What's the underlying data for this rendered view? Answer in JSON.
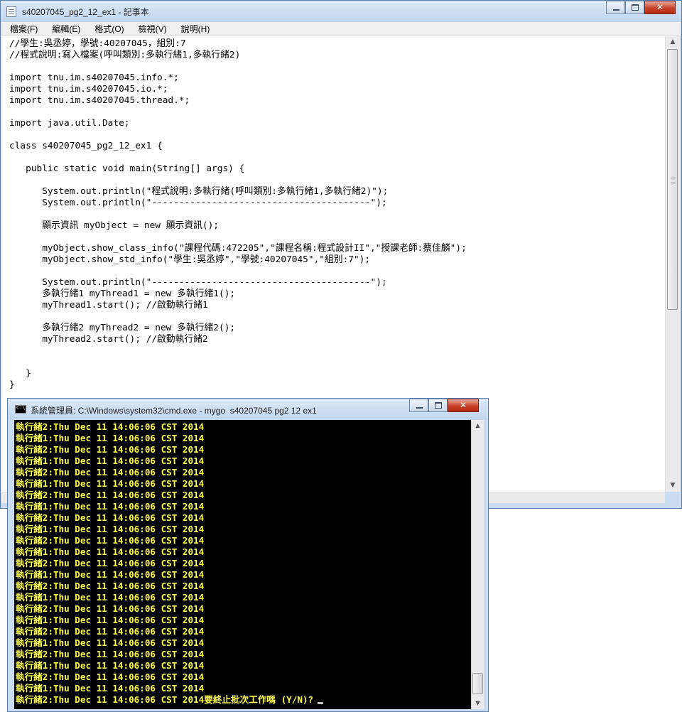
{
  "notepad": {
    "title": "s40207045_pg2_12_ex1 - 記事本",
    "menu": [
      "檔案(F)",
      "編輯(E)",
      "格式(O)",
      "檢視(V)",
      "說明(H)"
    ],
    "code_lines": [
      "//學生:吳丞婷，學號:40207045，組別:7",
      "//程式說明:寫入檔案(呼叫類別:多執行緒1,多執行緒2)",
      "",
      "import tnu.im.s40207045.info.*;",
      "import tnu.im.s40207045.io.*;",
      "import tnu.im.s40207045.thread.*;",
      "",
      "import java.util.Date;",
      "",
      "class s40207045_pg2_12_ex1 {",
      "",
      "   public static void main(String[] args) {",
      "",
      "      System.out.println(\"程式說明:多執行緒(呼叫類別:多執行緒1,多執行緒2)\");",
      "      System.out.println(\"----------------------------------------\");",
      "",
      "      顯示資訊 myObject = new 顯示資訊();",
      "",
      "      myObject.show_class_info(\"課程代碼:472205\",\"課程名稱:程式設計II\",\"授課老師:蔡佳麟\");",
      "      myObject.show_std_info(\"學生:吳丞婷\",\"學號:40207045\",\"組別:7\");",
      "",
      "      System.out.println(\"----------------------------------------\");",
      "      多執行緒1 myThread1 = new 多執行緒1();",
      "      myThread1.start(); //啟動執行緒1",
      "",
      "      多執行緒2 myThread2 = new 多執行緒2();",
      "      myThread2.start(); //啟動執行緒2",
      "",
      "",
      "   }",
      "}"
    ]
  },
  "console": {
    "title": "系統管理員: C:\\Windows\\system32\\cmd.exe - mygo  s40207045 pg2 12 ex1",
    "output_lines": [
      "執行緒2:Thu Dec 11 14:06:06 CST 2014",
      "執行緒1:Thu Dec 11 14:06:06 CST 2014",
      "執行緒2:Thu Dec 11 14:06:06 CST 2014",
      "執行緒1:Thu Dec 11 14:06:06 CST 2014",
      "執行緒2:Thu Dec 11 14:06:06 CST 2014",
      "執行緒1:Thu Dec 11 14:06:06 CST 2014",
      "執行緒2:Thu Dec 11 14:06:06 CST 2014",
      "執行緒1:Thu Dec 11 14:06:06 CST 2014",
      "執行緒2:Thu Dec 11 14:06:06 CST 2014",
      "執行緒1:Thu Dec 11 14:06:06 CST 2014",
      "執行緒2:Thu Dec 11 14:06:06 CST 2014",
      "執行緒1:Thu Dec 11 14:06:06 CST 2014",
      "執行緒2:Thu Dec 11 14:06:06 CST 2014",
      "執行緒1:Thu Dec 11 14:06:06 CST 2014",
      "執行緒2:Thu Dec 11 14:06:06 CST 2014",
      "執行緒1:Thu Dec 11 14:06:06 CST 2014",
      "執行緒2:Thu Dec 11 14:06:06 CST 2014",
      "執行緒1:Thu Dec 11 14:06:06 CST 2014",
      "執行緒2:Thu Dec 11 14:06:06 CST 2014",
      "執行緒1:Thu Dec 11 14:06:06 CST 2014",
      "執行緒2:Thu Dec 11 14:06:06 CST 2014",
      "執行緒1:Thu Dec 11 14:06:06 CST 2014",
      "執行緒2:Thu Dec 11 14:06:06 CST 2014",
      "執行緒1:Thu Dec 11 14:06:06 CST 2014"
    ],
    "last_line": "執行緒2:Thu Dec 11 14:06:06 CST 2014",
    "prompt": "要終止批次工作嗎 (Y/N)?"
  },
  "colors": {
    "console_text": "#ffff4a",
    "console_bg": "#000000",
    "titlebar": "#c9dcf2",
    "close_button": "#c8432b"
  },
  "icons": [
    "notepad-icon",
    "cmd-icon",
    "minimize-icon",
    "maximize-icon",
    "close-icon",
    "scroll-up-arrow-icon",
    "scroll-down-arrow-icon"
  ]
}
